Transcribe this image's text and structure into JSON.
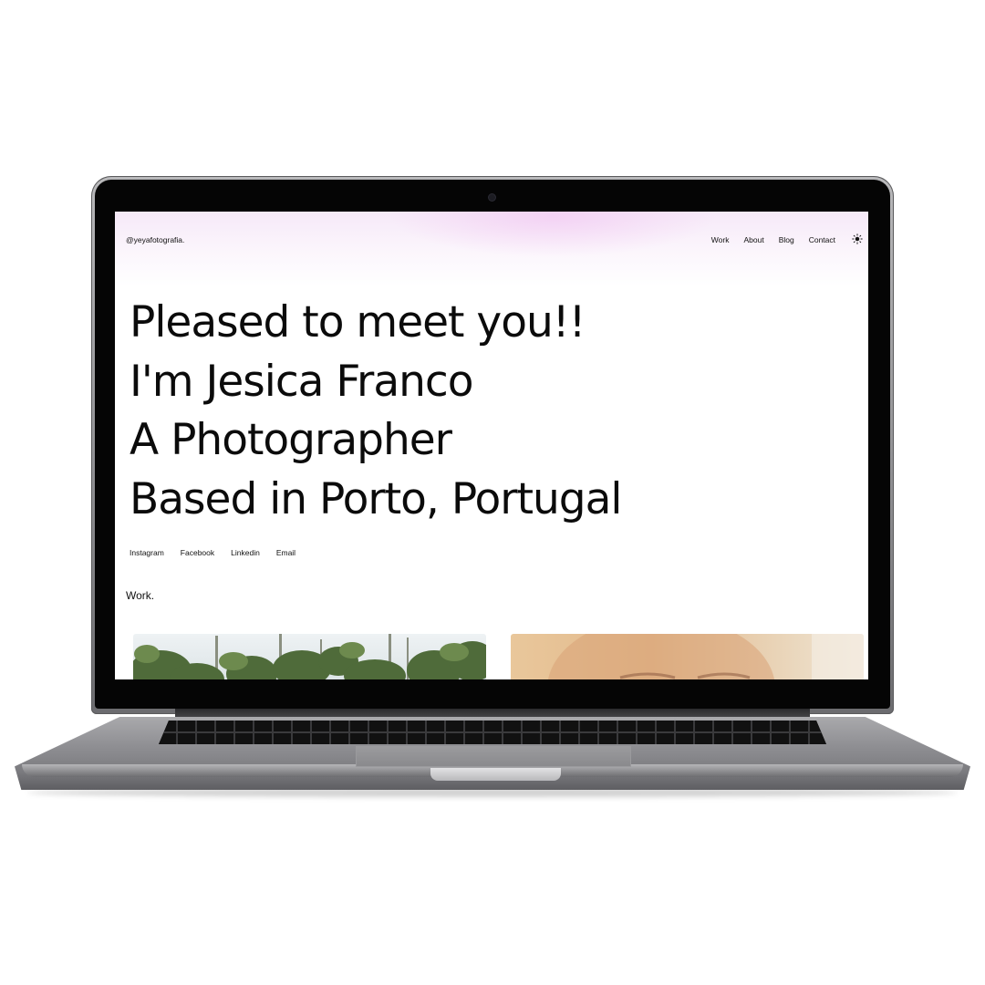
{
  "site": {
    "brand": "@yeyafotografia.",
    "nav": [
      "Work",
      "About",
      "Blog",
      "Contact"
    ],
    "theme_toggle_icon": "sun-icon"
  },
  "hero": {
    "lines": [
      "Pleased to meet you!!",
      "I'm Jesica Franco",
      "A Photographer",
      "Based in Porto, Portugal"
    ]
  },
  "social": [
    "Instagram",
    "Facebook",
    "Linkedin",
    "Email"
  ],
  "work": {
    "title": "Work."
  },
  "colors": {
    "accent_glow": "#f3d9f5",
    "text": "#111111",
    "laptop_body": "#8d8d90"
  }
}
